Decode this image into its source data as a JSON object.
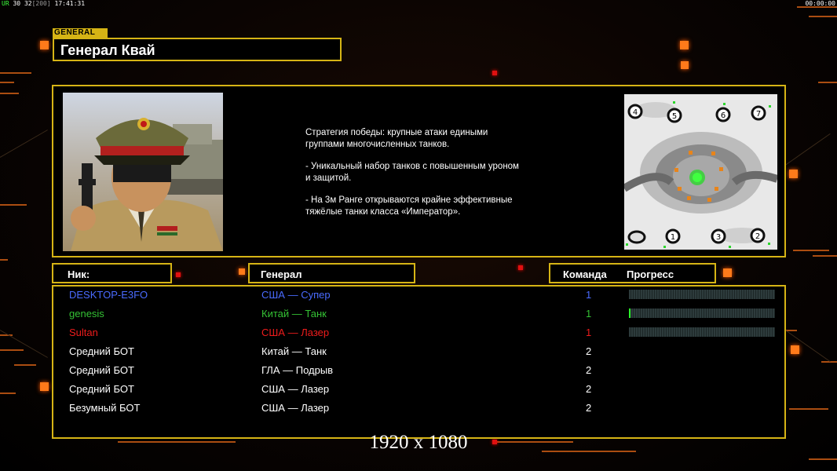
{
  "hud": {
    "fps_parts": [
      "UR",
      "30",
      "32",
      "[200]",
      "17:41:31"
    ],
    "clock": "00:00:00"
  },
  "general": {
    "tag": "GENERAL",
    "name": "Генерал Квай",
    "description": [
      "Стратегия победы: крупные атаки едиными\n группами многочисленных танков.",
      "- Уникальный набор танков с повышенным уроном\n и защитой.",
      "- На 3м Ранге открываются крайне эффективные\n тяжёлые танки класса «Император»."
    ]
  },
  "map": {
    "slots": [
      "4",
      "5",
      "6",
      "7",
      "1",
      "3",
      "2",
      ""
    ]
  },
  "columns": {
    "nick": "Ник:",
    "general": "Генерал",
    "team": "Команда",
    "progress": "Прогресс"
  },
  "players": [
    {
      "nick": "DESKTOP-E3FO",
      "general": "США — Супер",
      "team": "1",
      "color": "#4a6bff",
      "progress": 0,
      "has_bar": true
    },
    {
      "nick": "genesis",
      "general": "Китай — Танк",
      "team": "1",
      "color": "#34c234",
      "progress": 0.01,
      "has_bar": true
    },
    {
      "nick": "Sultan",
      "general": "США — Лазер",
      "team": "1",
      "color": "#ee1c1c",
      "progress": 0,
      "has_bar": true
    },
    {
      "nick": "Средний БОТ",
      "general": "Китай — Танк",
      "team": "2",
      "color": "#ffffff",
      "progress": null,
      "has_bar": false
    },
    {
      "nick": "Средний БОТ",
      "general": "ГЛА — Подрыв",
      "team": "2",
      "color": "#ffffff",
      "progress": null,
      "has_bar": false
    },
    {
      "nick": "Средний БОТ",
      "general": "США — Лазер",
      "team": "2",
      "color": "#ffffff",
      "progress": null,
      "has_bar": false
    },
    {
      "nick": "Безумный БОТ",
      "general": "США — Лазер",
      "team": "2",
      "color": "#ffffff",
      "progress": null,
      "has_bar": false
    }
  ],
  "resolution_text": "1920 x 1080",
  "colors": {
    "frame": "#d6b415",
    "accent_orange": "#ff7a1a",
    "progress_fill": "#2cff2c"
  }
}
